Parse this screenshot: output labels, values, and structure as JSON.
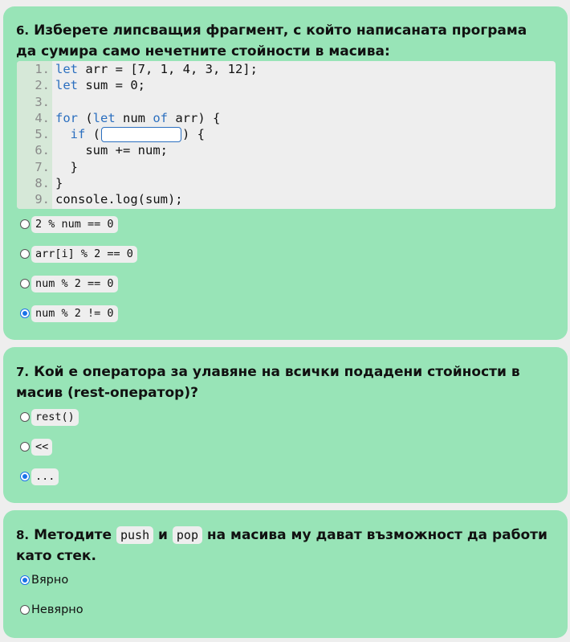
{
  "questions": {
    "q6": {
      "number": "6.",
      "title": "Изберете липсващия фрагмент, с който написаната програма да сумира само нечетните стойности в масива:",
      "code_lines": [
        {
          "n": "1.",
          "parts": [
            {
              "k": true,
              "t": "let"
            },
            {
              "t": " arr = [7, 1, 4, 3, 12];"
            }
          ]
        },
        {
          "n": "2.",
          "parts": [
            {
              "k": true,
              "t": "let"
            },
            {
              "t": " sum = 0;"
            }
          ]
        },
        {
          "n": "3.",
          "parts": []
        },
        {
          "n": "4.",
          "parts": [
            {
              "k": true,
              "t": "for"
            },
            {
              "t": " ("
            },
            {
              "k": true,
              "t": "let"
            },
            {
              "t": " num "
            },
            {
              "k": true,
              "t": "of"
            },
            {
              "t": " arr) {"
            }
          ]
        },
        {
          "n": "5.",
          "parts": [
            {
              "t": "  "
            },
            {
              "k": true,
              "t": "if"
            },
            {
              "t": " ("
            },
            {
              "blank": true
            },
            {
              "t": ") {"
            }
          ]
        },
        {
          "n": "6.",
          "parts": [
            {
              "t": "    sum += num;"
            }
          ]
        },
        {
          "n": "7.",
          "parts": [
            {
              "t": "  }"
            }
          ]
        },
        {
          "n": "8.",
          "parts": [
            {
              "t": "}"
            }
          ]
        },
        {
          "n": "9.",
          "parts": [
            {
              "t": "console.log(sum);"
            }
          ]
        }
      ],
      "options": [
        {
          "label": "2 % num == 0",
          "checked": false
        },
        {
          "label": "arr[i] % 2 == 0",
          "checked": false
        },
        {
          "label": "num % 2 == 0",
          "checked": false
        },
        {
          "label": "num % 2 != 0",
          "checked": true
        }
      ]
    },
    "q7": {
      "number": "7.",
      "title": "Кой е оператора за улавяне на всички подадени стойности в масив (rest-оператор)?",
      "options": [
        {
          "label": "rest()",
          "checked": false
        },
        {
          "label": "<<",
          "checked": false
        },
        {
          "label": "...",
          "checked": true
        }
      ]
    },
    "q8": {
      "number": "8.",
      "title_part1": "Методите",
      "code1": "push",
      "title_part2": "и",
      "code2": "pop",
      "title_part3": "на масива му дават възможност да работи като стек.",
      "options": [
        {
          "label": "Вярно",
          "checked": true
        },
        {
          "label": "Невярно",
          "checked": false
        }
      ]
    }
  },
  "colors": {
    "card_bg": "#98e4b7",
    "page_bg": "#eeeeee",
    "keyword": "#2b6fbf",
    "radio_checked": "#1a73e8"
  }
}
